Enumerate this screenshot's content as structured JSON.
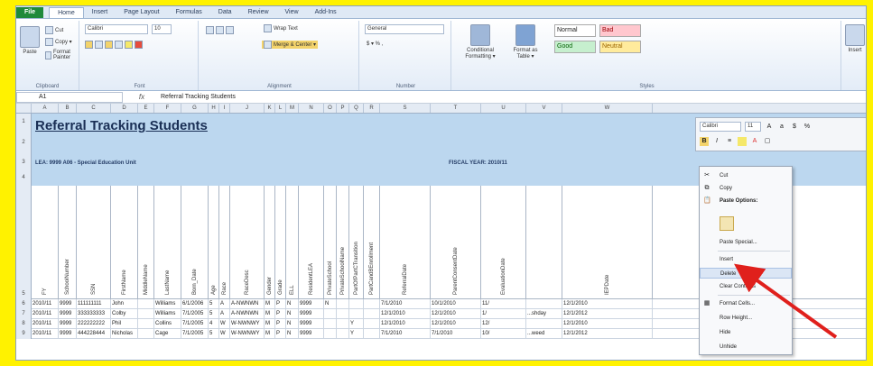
{
  "ribbon": {
    "tabs": [
      "File",
      "Home",
      "Insert",
      "Page Layout",
      "Formulas",
      "Data",
      "Review",
      "View",
      "Add-Ins"
    ],
    "clipboard": {
      "cut": "Cut",
      "copy": "Copy ▾",
      "paste": "Paste",
      "format_painter": "Format Painter",
      "label": "Clipboard"
    },
    "font": {
      "name": "Calibri",
      "size": "10",
      "label": "Font"
    },
    "alignment": {
      "wrap": "Wrap Text",
      "merge": "Merge & Center ▾",
      "label": "Alignment"
    },
    "number": {
      "format": "General",
      "symbols": "$ ▾ % ,",
      "label": "Number"
    },
    "styles": {
      "conditional": "Conditional Formatting ▾",
      "as_table": "Format as Table ▾",
      "normal": "Normal",
      "bad": "Bad",
      "good": "Good",
      "neutral": "Neutral",
      "label": "Styles"
    },
    "insert": "Insert"
  },
  "formula_bar": {
    "cell": "A1",
    "fx": "fx",
    "content": "Referral Tracking Students"
  },
  "columns": [
    "A",
    "B",
    "C",
    "D",
    "E",
    "F",
    "G",
    "H",
    "I",
    "J",
    "K",
    "L",
    "M",
    "N",
    "O",
    "P",
    "Q",
    "R",
    "S",
    "T",
    "U",
    "V",
    "W"
  ],
  "rows": [
    "1",
    "2",
    "3",
    "4",
    "5",
    "6",
    "7",
    "8",
    "9"
  ],
  "sheet": {
    "title": "Referral Tracking Students",
    "lea": "LEA: 9999 A06 - Special Education Unit",
    "fiscal": "FISCAL YEAR: 2010/11",
    "headers": [
      "FY",
      "SchoolNumber",
      "SSN",
      "FirstName",
      "MiddleName",
      "LastName",
      "Born_Date",
      "Age",
      "Race",
      "RaceDesc",
      "Gender",
      "Grade",
      "ELL",
      "ResidentLEA",
      "PrivateSchool",
      "PrivateSchoolName",
      "PartOfPartCTransition",
      "PartCandBEnrollment",
      "ReferralDate",
      "ParentConsentDate",
      "EvaluationDate",
      "",
      "IEPDate"
    ],
    "data": [
      [
        "2010/11",
        "9999",
        "111111111",
        "John",
        "",
        "Williams",
        "6/1/2006",
        "5",
        "A",
        "A-NWNWN",
        "M",
        "P",
        "N",
        "9999",
        "N",
        "",
        "",
        "",
        "7/1/2010",
        "10/1/2010",
        "11/",
        "",
        "12/1/2010"
      ],
      [
        "2010/11",
        "9999",
        "333333333",
        "Colby",
        "",
        "Williams",
        "7/1/2005",
        "5",
        "A",
        "A-NWNWN",
        "M",
        "P",
        "N",
        "9999",
        "",
        "",
        "",
        "",
        "12/1/2010",
        "12/1/2010",
        "1/",
        "...shday",
        "12/1/2012"
      ],
      [
        "2010/11",
        "9999",
        "222222222",
        "Phil",
        "",
        "Collins",
        "7/1/2005",
        "4",
        "W",
        "W-NWNWY",
        "M",
        "P",
        "N",
        "9999",
        "",
        "",
        "Y",
        "",
        "12/1/2010",
        "12/1/2010",
        "12/",
        "",
        "12/1/2010"
      ],
      [
        "2010/11",
        "9999",
        "444228444",
        "Nicholas",
        "",
        "Cage",
        "7/1/2005",
        "5",
        "W",
        "W-NWNWY",
        "M",
        "P",
        "N",
        "9999",
        "",
        "",
        "Y",
        "",
        "7/1/2010",
        "7/1/2010",
        "10/",
        "...weed",
        "12/1/2012"
      ]
    ]
  },
  "mini_toolbar": {
    "font": "Calibri",
    "size": "11",
    "bold": "B",
    "italic": "I"
  },
  "context_menu": {
    "items": [
      "Cut",
      "Copy",
      "Paste Options:",
      "Paste Special...",
      "Insert",
      "Delete",
      "Clear Contents",
      "Format Cells...",
      "Row Height...",
      "Hide",
      "Unhide"
    ],
    "highlighted": "Delete"
  },
  "colors": {
    "accent": "#1f8a3b",
    "banner": "#bcd7ef",
    "arrow": "#e0201c",
    "border": "#fff200"
  }
}
